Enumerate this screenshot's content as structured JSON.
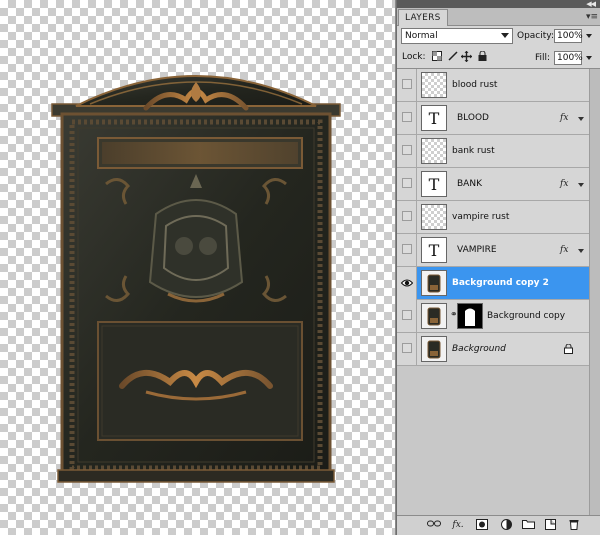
{
  "panel": {
    "tab_label": "LAYERS",
    "blend_mode": "Normal",
    "opacity_label": "Opacity:",
    "opacity_value": "100%",
    "lock_label": "Lock:",
    "fill_label": "Fill:",
    "fill_value": "100%"
  },
  "layers": [
    {
      "name": "blood rust",
      "kind": "empty",
      "visible": false,
      "selected": false
    },
    {
      "name": "BLOOD",
      "kind": "text",
      "visible": false,
      "selected": false,
      "fx": "fx"
    },
    {
      "name": "bank rust",
      "kind": "empty",
      "visible": false,
      "selected": false
    },
    {
      "name": "BANK",
      "kind": "text",
      "visible": false,
      "selected": false,
      "fx": "fx"
    },
    {
      "name": "vampire rust",
      "kind": "empty",
      "visible": false,
      "selected": false
    },
    {
      "name": "VAMPIRE",
      "kind": "text",
      "visible": false,
      "selected": false,
      "fx": "fx"
    },
    {
      "name": "Background copy 2",
      "kind": "photo",
      "visible": true,
      "selected": true
    },
    {
      "name": "Background copy",
      "kind": "photo-mask",
      "visible": false,
      "selected": false
    },
    {
      "name": "Background",
      "kind": "photo",
      "visible": false,
      "selected": false,
      "locked": true
    }
  ],
  "icons": {
    "text_thumb_glyph": "T",
    "chain_glyph": "⚭"
  },
  "colors": {
    "selection": "#3b95ef",
    "panel_bg": "#d6d6d6",
    "mailbox_metal": "#2a2d27",
    "mailbox_rust": "#b9773a"
  }
}
